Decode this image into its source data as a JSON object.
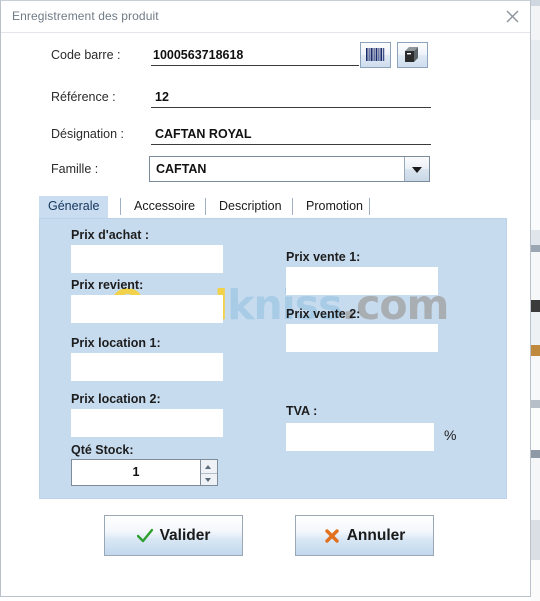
{
  "window": {
    "title": "Enregistrement des produit",
    "close_icon": "close-icon"
  },
  "form": {
    "fields": [
      {
        "label": "Code barre :",
        "value": "1000563718618",
        "name": "code-barre"
      },
      {
        "label": "Référence :",
        "value": "12",
        "name": "reference"
      },
      {
        "label": "Désignation :",
        "value": "CAFTAN ROYAL",
        "name": "designation"
      }
    ],
    "famille": {
      "label": "Famille :",
      "value": "CAFTAN",
      "dropdown_icon": "chevron-down-icon"
    },
    "icon_buttons": [
      {
        "name": "barcode-icon",
        "title": "barcode"
      },
      {
        "name": "package-box-icon",
        "title": "package"
      }
    ]
  },
  "tabs": [
    {
      "label": "Génerale",
      "active": true
    },
    {
      "label": "Accessoire",
      "active": false
    },
    {
      "label": "Description",
      "active": false
    },
    {
      "label": "Promotion",
      "active": false
    }
  ],
  "panel": {
    "left_fields": [
      {
        "label": "Prix d'achat :",
        "value": "",
        "name": "prix-achat"
      },
      {
        "label": "Prix revient:",
        "value": "",
        "name": "prix-revient"
      },
      {
        "label": "Prix location 1:",
        "value": "",
        "name": "prix-location-1"
      },
      {
        "label": "Prix location 2:",
        "value": "",
        "name": "prix-location-2"
      }
    ],
    "right_fields": [
      {
        "label": "Prix vente 1:",
        "value": "",
        "name": "prix-vente-1"
      },
      {
        "label": "Prix vente 2:",
        "value": "",
        "name": "prix-vente-2"
      },
      {
        "label": "TVA :",
        "value": "",
        "name": "tva",
        "suffix": "%"
      }
    ],
    "stock": {
      "label": "Qté Stock:",
      "value": "1"
    }
  },
  "watermark": {
    "part1": "Oued",
    "part2": "kniss",
    "part3": ".com"
  },
  "buttons": {
    "validate": {
      "label": "Valider",
      "icon": "check-icon",
      "color": "#2f9e2f"
    },
    "cancel": {
      "label": "Annuler",
      "icon": "cross-icon",
      "color": "#e2711d"
    }
  },
  "colors": {
    "panel_bg": "#c7dbef",
    "tab_active_bg": "#c9dcf0",
    "title_text": "#6f7b86"
  }
}
